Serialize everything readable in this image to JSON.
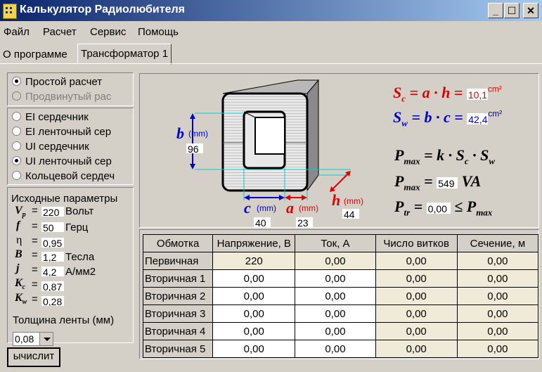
{
  "window": {
    "title": "Калькулятор Радиолюбителя",
    "btn_min": "_",
    "btn_max": "☐",
    "btn_close": "✕"
  },
  "menu": [
    "Файл",
    "Расчет",
    "Сервис",
    "Помощь"
  ],
  "tabs": [
    "О программе",
    "Трансформатор 1"
  ],
  "calc_mode": {
    "options": [
      "Простой расчет",
      "Продвинутый рас"
    ],
    "selected": 0,
    "disabled": [
      1
    ]
  },
  "core_type": {
    "options": [
      "EI сердечник",
      "EI ленточный сер",
      "UI сердечник",
      "UI ленточный сер",
      "Кольцевой сердеч"
    ],
    "selected": 3
  },
  "params": {
    "heading": "Исходные параметры",
    "items": [
      {
        "sym": "V",
        "sub": "p",
        "eq": "=",
        "value": "220",
        "unit": "Вольт"
      },
      {
        "sym": "f",
        "sub": "",
        "eq": "=",
        "value": "50",
        "unit": "Герц"
      },
      {
        "sym": "η",
        "sub": "",
        "eq": "=",
        "value": "0,95",
        "unit": ""
      },
      {
        "sym": "B",
        "sub": "",
        "eq": "=",
        "value": "1,2",
        "unit": "Тесла"
      },
      {
        "sym": "j",
        "sub": "",
        "eq": "=",
        "value": "4,2",
        "unit": "А/мм2"
      },
      {
        "sym": "K",
        "sub": "c",
        "eq": "=",
        "value": "0,87",
        "unit": ""
      },
      {
        "sym": "K",
        "sub": "w",
        "eq": "=",
        "value": "0,28",
        "unit": ""
      }
    ],
    "tape_label": "Толщина ленты (мм)",
    "tape_value": "0,08"
  },
  "calc_button": "ычислит",
  "diagram": {
    "b_label": "b",
    "b_unit": "(mm)",
    "b_value": "96",
    "c_label": "c",
    "c_unit": "(mm)",
    "c_value": "40",
    "a_label": "a",
    "a_unit": "(mm)",
    "a_value": "23",
    "h_label": "h",
    "h_unit": "(mm)",
    "h_value": "44",
    "sc": {
      "lhs": "S",
      "lsub": "c",
      "rhs": "= a · h =",
      "value": "10,1",
      "unit": "cm²",
      "color": "#e00000"
    },
    "sw": {
      "lhs": "S",
      "lsub": "w",
      "rhs": "= b · c =",
      "value": "42,4",
      "unit": "cm²",
      "color": "#0000cc"
    },
    "pmax_formula": {
      "lhs": "P",
      "lsub": "max",
      "rhs1": "= k · S",
      "sub1": "c",
      "rhs2": " · S",
      "sub2": "w"
    },
    "pmax_value": {
      "lhs": "P",
      "lsub": "max",
      "eq": "=",
      "value": "549",
      "unit": "VA"
    },
    "ptr": {
      "lhs": "P",
      "lsub": "tr",
      "eq": "=",
      "value": "0,00",
      "cmp": "≤ P",
      "csub": "max"
    }
  },
  "windings": {
    "headers": [
      "Обмотка",
      "Напряжение, В",
      "Ток, А",
      "Число витков",
      "Сечение, м"
    ],
    "rows": [
      [
        "Первичная",
        "220",
        "0,00",
        "0,00",
        "0,00"
      ],
      [
        "Вторичная 1",
        "0,00",
        "0,00",
        "0,00",
        "0,00"
      ],
      [
        "Вторичная 2",
        "0,00",
        "0,00",
        "0,00",
        "0,00"
      ],
      [
        "Вторичная 3",
        "0,00",
        "0,00",
        "0,00",
        "0,00"
      ],
      [
        "Вторичная 4",
        "0,00",
        "0,00",
        "0,00",
        "0,00"
      ],
      [
        "Вторичная 5",
        "0,00",
        "0,00",
        "0,00",
        "0,00"
      ]
    ]
  }
}
